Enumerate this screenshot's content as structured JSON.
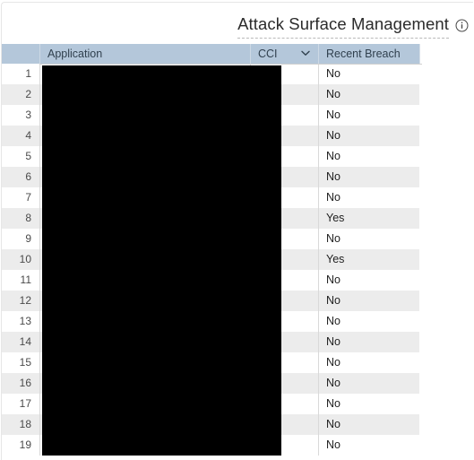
{
  "page": {
    "title": "Attack Surface Management",
    "info_icon": "info-icon"
  },
  "table": {
    "columns": [
      {
        "key": "rownum",
        "label": ""
      },
      {
        "key": "application",
        "label": "Application"
      },
      {
        "key": "cci",
        "label": "CCI",
        "sort_icon": "chevron-down-icon"
      },
      {
        "key": "recent_breach",
        "label": "Recent Breach"
      }
    ],
    "rows": [
      {
        "num": "1",
        "application": "",
        "cci": "",
        "recent_breach": "No"
      },
      {
        "num": "2",
        "application": "",
        "cci": "",
        "recent_breach": "No"
      },
      {
        "num": "3",
        "application": "",
        "cci": "",
        "recent_breach": "No"
      },
      {
        "num": "4",
        "application": "",
        "cci": "",
        "recent_breach": "No"
      },
      {
        "num": "5",
        "application": "",
        "cci": "",
        "recent_breach": "No"
      },
      {
        "num": "6",
        "application": "",
        "cci": "",
        "recent_breach": "No"
      },
      {
        "num": "7",
        "application": "",
        "cci": "",
        "recent_breach": "No"
      },
      {
        "num": "8",
        "application": "",
        "cci": "",
        "recent_breach": "Yes"
      },
      {
        "num": "9",
        "application": "",
        "cci": "",
        "recent_breach": "No"
      },
      {
        "num": "10",
        "application": "",
        "cci": "",
        "recent_breach": "Yes"
      },
      {
        "num": "11",
        "application": "",
        "cci": "",
        "recent_breach": "No"
      },
      {
        "num": "12",
        "application": "",
        "cci": "",
        "recent_breach": "No"
      },
      {
        "num": "13",
        "application": "",
        "cci": "",
        "recent_breach": "No"
      },
      {
        "num": "14",
        "application": "",
        "cci": "",
        "recent_breach": "No"
      },
      {
        "num": "15",
        "application": "",
        "cci": "",
        "recent_breach": "No"
      },
      {
        "num": "16",
        "application": "",
        "cci": "",
        "recent_breach": "No"
      },
      {
        "num": "17",
        "application": "",
        "cci": "",
        "recent_breach": "No"
      },
      {
        "num": "18",
        "application": "",
        "cci": "",
        "recent_breach": "No"
      },
      {
        "num": "19",
        "application": "",
        "cci": "",
        "recent_breach": "No"
      }
    ]
  },
  "colors": {
    "header_background": "#b4c7da",
    "row_stripe": "#ececec",
    "row_base": "#ffffff",
    "redaction": "#000000",
    "title_text": "#2b2b2b"
  }
}
